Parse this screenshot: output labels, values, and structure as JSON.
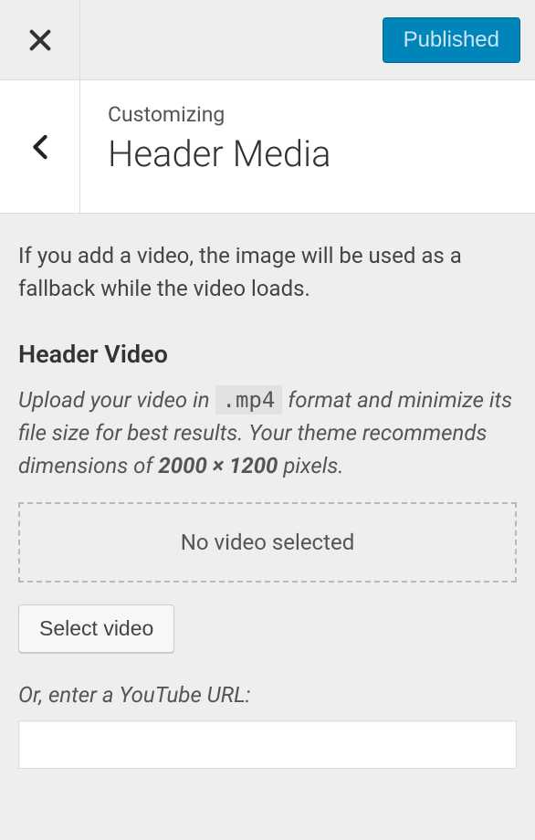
{
  "topbar": {
    "published_label": "Published"
  },
  "header": {
    "breadcrumb": "Customizing",
    "title": "Header Media"
  },
  "intro": "If you add a video, the image will be used as a fallback while the video loads.",
  "video_section": {
    "heading": "Header Video",
    "help_pre": "Upload your video in ",
    "help_code": ".mp4",
    "help_mid": " format and minimize its file size for best results. Your theme recommends dimensions of ",
    "help_dims": "2000 × 1200",
    "help_post": " pixels.",
    "dropzone_text": "No video selected",
    "select_button": "Select video",
    "youtube_label": "Or, enter a YouTube URL:",
    "youtube_value": ""
  }
}
